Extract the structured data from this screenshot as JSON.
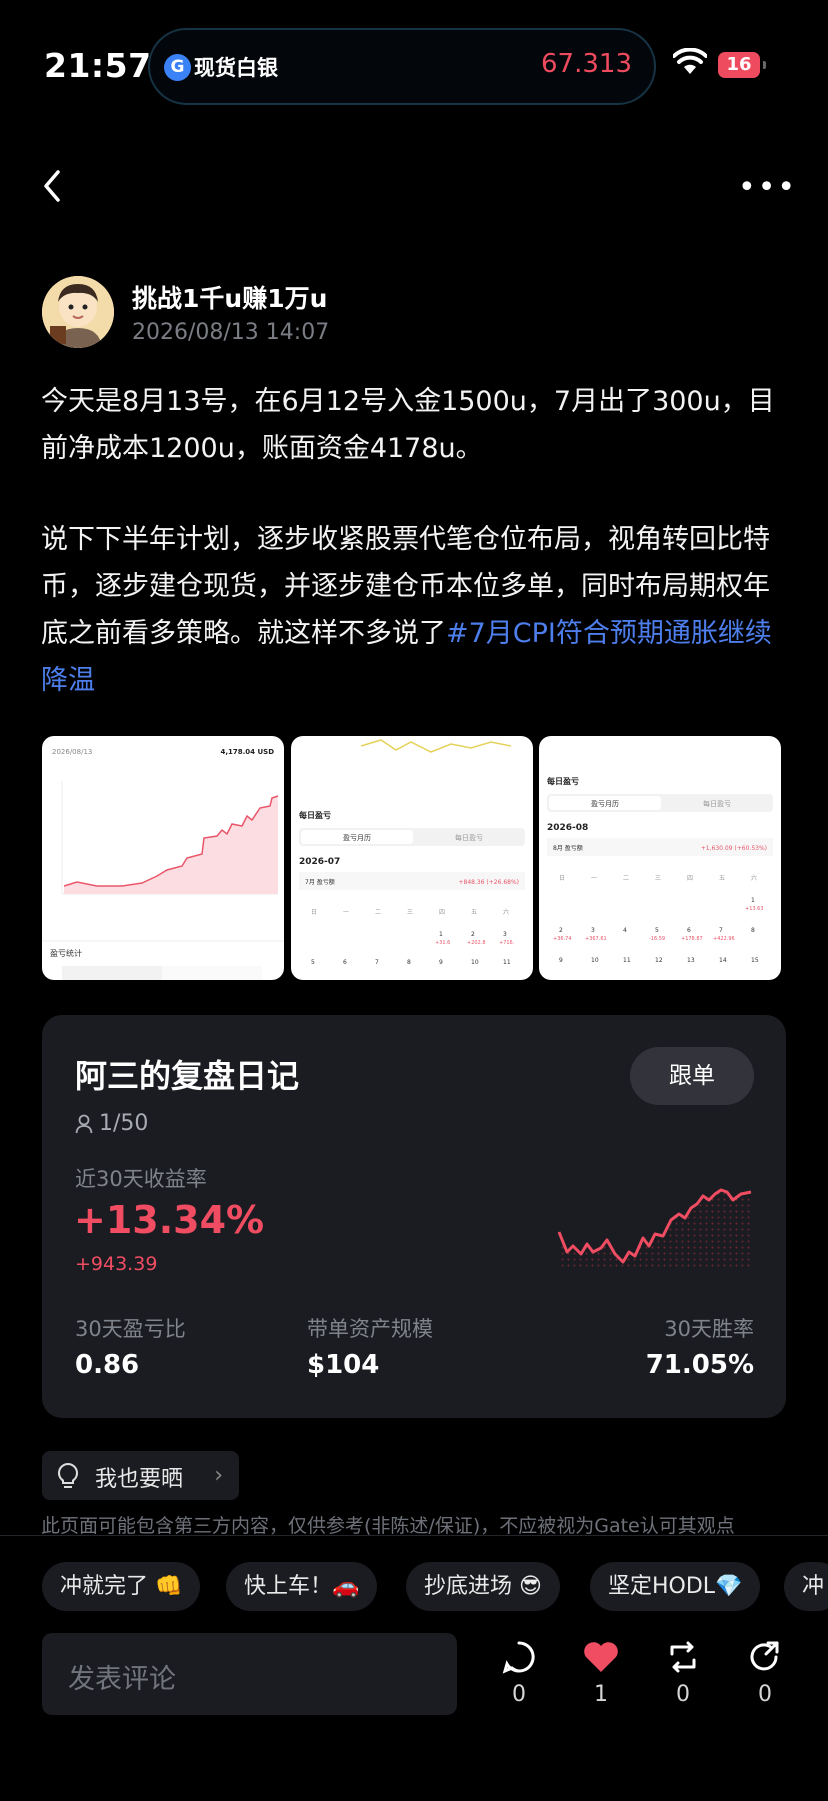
{
  "status_bar": {
    "time": "21:57",
    "ticker_name": "现货白银",
    "ticker_price": "67.313",
    "battery": "16"
  },
  "post": {
    "author": "挑战1千u赚1万u",
    "datetime": "2026/08/13 14:07",
    "paragraph1": "今天是8月13号，在6月12号入金1500u，7月出了300u，目前净成本1200u，账面资金4178u。",
    "paragraph2": "说下下半年计划，逐步收紧股票代笔仓位布局，视角转回比特币，逐步建仓现货，并逐步建仓币本位多单，同时布局期权年底之前看多策略。就这样不多说了",
    "hashtag": "#7月CPI符合预期通胀继续降温"
  },
  "thumbnails": {
    "t1": {
      "date": "2026/08/13",
      "amount": "4,178.04 USD",
      "footer": "盈亏统计"
    },
    "t2": {
      "title": "每日盈亏",
      "tab1": "盈亏月历",
      "tab2": "每日盈亏",
      "month": "2026-07",
      "row": "7月 盈亏额",
      "value": "+848.36 (+26.68%)"
    },
    "t3": {
      "title": "每日盈亏",
      "tab1": "盈亏月历",
      "tab2": "每日盈亏",
      "month": "2026-08",
      "row": "8月 盈亏额",
      "value": "+1,630.09 (+60.53%)"
    }
  },
  "trader_card": {
    "name": "阿三的复盘日记",
    "follow_label": "跟单",
    "followers": "1/50",
    "return_label": "近30天收益率",
    "return_pct": "+13.34%",
    "return_abs": "+943.39",
    "stats": [
      {
        "label": "30天盈亏比",
        "value": "0.86"
      },
      {
        "label": "带单资产规模",
        "value": "$104"
      },
      {
        "label": "30天胜率",
        "value": "71.05%"
      }
    ]
  },
  "share_label": "我也要晒",
  "disclaimer": "此页面可能包含第三方内容，仅供参考(非陈述/保证)，不应被视为Gate认可其观点",
  "quick_replies": [
    "冲就完了 👊",
    "快上车！🚗",
    "抄底进场 😎",
    "坚定HODL💎",
    "冲"
  ],
  "comment_placeholder": "发表评论",
  "actions": {
    "comments": "0",
    "likes": "1",
    "reposts": "0",
    "shares": "0"
  },
  "colors": {
    "accent_red": "#f04d62",
    "link_blue": "#4d7eeb",
    "card_bg": "#1b1c21"
  }
}
